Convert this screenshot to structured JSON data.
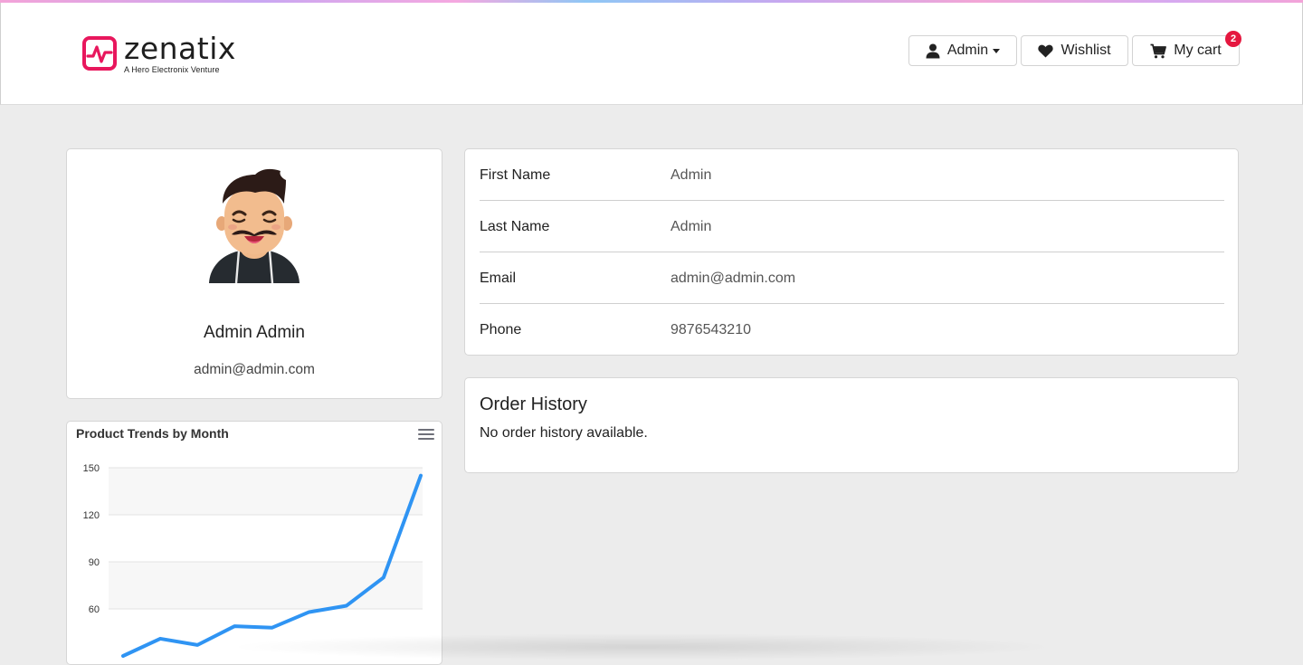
{
  "brand": {
    "name": "zenatix",
    "tagline": "A Hero Electronix Venture",
    "color": "#e8175d"
  },
  "header": {
    "user_label": "Admin",
    "wishlist_label": "Wishlist",
    "cart_label": "My cart",
    "cart_count": "2",
    "icons": [
      "user-icon",
      "heart-icon",
      "cart-icon"
    ]
  },
  "profile": {
    "name": "Admin Admin",
    "email": "admin@admin.com"
  },
  "details": [
    {
      "label": "First Name",
      "value": "Admin"
    },
    {
      "label": "Last Name",
      "value": "Admin"
    },
    {
      "label": "Email",
      "value": "admin@admin.com"
    },
    {
      "label": "Phone",
      "value": "9876543210"
    }
  ],
  "orders": {
    "title": "Order History",
    "empty_text": "No order history available."
  },
  "chart_data": {
    "type": "line",
    "title": "Product Trends by Month",
    "xlabel": "",
    "ylabel": "",
    "ylim": [
      30,
      150
    ],
    "y_ticks": [
      150,
      120,
      90,
      60
    ],
    "grid": true,
    "series": [
      {
        "values": [
          30,
          41,
          37,
          49,
          48,
          58,
          62,
          80,
          145
        ],
        "color": "#2f94f3"
      }
    ]
  }
}
